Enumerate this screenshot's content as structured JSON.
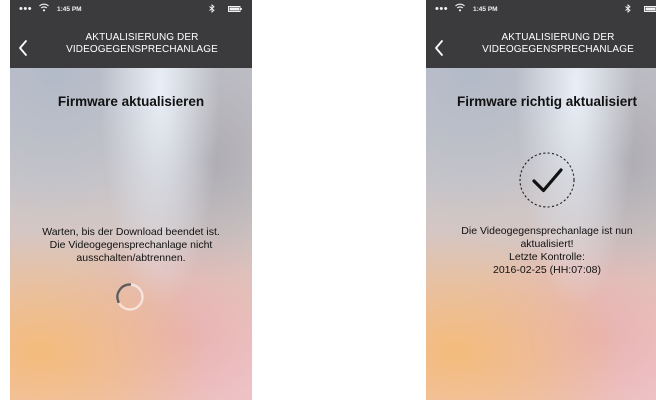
{
  "status_bar": {
    "signal": "•••",
    "time": "1:45 PM"
  },
  "header": {
    "title_line1": "AKTUALISIERUNG DER",
    "title_line2": "VIDEOGEGENSPRECHANLAGE"
  },
  "screens": [
    {
      "title": "Firmware aktualisieren",
      "message_lines": [
        "Warten, bis der Download beendet ist.",
        "Die Videogegensprechanlage nicht",
        "ausschalten/abtrennen."
      ]
    },
    {
      "title": "Firmware richtig aktualisiert",
      "message_lines": [
        "Die Videogegensprechanlage ist nun",
        "aktualisiert!",
        "Letzte Kontrolle:",
        "2016-02-25 (HH:07:08)"
      ]
    }
  ],
  "icons": {
    "wifi": "wifi-icon",
    "bluetooth": "bluetooth-icon",
    "battery": "battery-icon",
    "back": "chevron-left-icon",
    "spinner": "loading-spinner-icon",
    "success": "checkmark-circle-icon"
  }
}
